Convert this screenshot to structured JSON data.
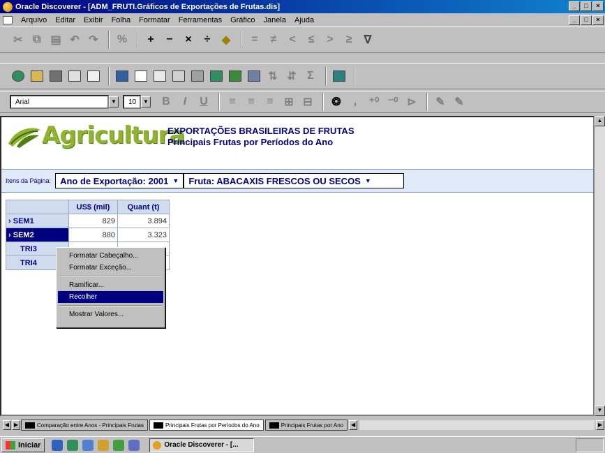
{
  "window": {
    "title": "Oracle Discoverer - [ADM_FRUTI.Gráficos de Exportações de Frutas.dis]"
  },
  "menu": [
    "Arquivo",
    "Editar",
    "Exibir",
    "Folha",
    "Formatar",
    "Ferramentas",
    "Gráfico",
    "Janela",
    "Ajuda"
  ],
  "font": {
    "name": "Arial",
    "size": "10"
  },
  "report": {
    "logo_text": "Agricultura",
    "title_line1": "EXPORTAÇÕES BRASILEIRAS DE FRUTAS",
    "title_line2": "Principais Frutas por Períodos do Ano"
  },
  "page_items": {
    "label": "Itens da Página:",
    "year": "Ano de Exportação: 2001",
    "fruit": "Fruta: ABACAXIS FRESCOS OU SECOS"
  },
  "table": {
    "columns": [
      "US$ (mil)",
      "Quant (t)"
    ],
    "rows": [
      {
        "label": "SEM1",
        "usd": "829",
        "qty": "3.894"
      },
      {
        "label": "SEM2",
        "usd": "880",
        "qty": "3.323"
      },
      {
        "label": "TRI3",
        "usd": "",
        "qty": ""
      },
      {
        "label": "TRI4",
        "usd": "",
        "qty": ""
      }
    ]
  },
  "context_menu": {
    "items": [
      "Formatar Cabeçalho...",
      "Formatar Exceção...",
      "Ramificar...",
      "Recolher",
      "Mostrar Valores..."
    ],
    "highlighted": "Recolher"
  },
  "sheets": [
    "Comparação entre Anos - Principais Frutas",
    "Principais Frutas por Períodos do Ano",
    "Principais Frutas por Ano"
  ],
  "taskbar": {
    "start": "Iniciar",
    "task": "Oracle Discoverer - [..."
  },
  "colors": {
    "title_bar": "#000080",
    "header_band": "#dfe9f7",
    "logo_green": "#8db32f",
    "report_title": "#000080"
  }
}
